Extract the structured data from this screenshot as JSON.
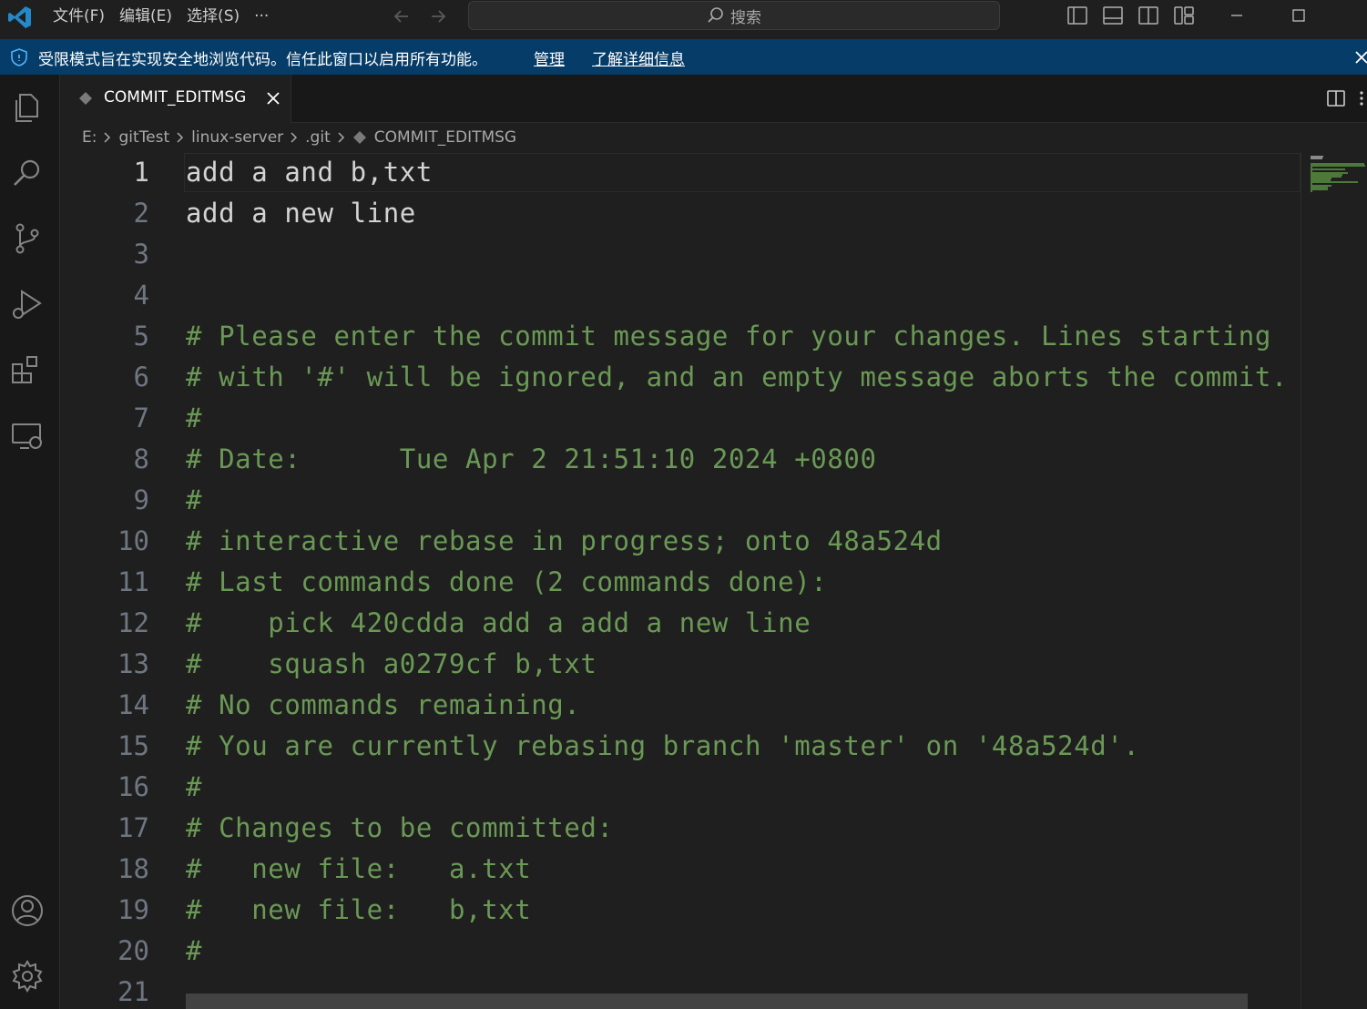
{
  "titlebar": {
    "menu": [
      "文件(F)",
      "编辑(E)",
      "选择(S)",
      "···"
    ],
    "search_label": "搜索"
  },
  "banner": {
    "message": "受限模式旨在实现安全地浏览代码。信任此窗口以启用所有功能。",
    "manage_label": "管理",
    "learn_more_label": "了解详细信息"
  },
  "tab": {
    "label": "COMMIT_EDITMSG"
  },
  "breadcrumbs": [
    "E:",
    "gitTest",
    "linux-server",
    ".git",
    "COMMIT_EDITMSG"
  ],
  "editor": {
    "lines": [
      {
        "num": "1",
        "text": "add a and b,txt",
        "comment": false
      },
      {
        "num": "2",
        "text": "add a new line",
        "comment": false
      },
      {
        "num": "3",
        "text": "",
        "comment": false
      },
      {
        "num": "4",
        "text": "",
        "comment": false
      },
      {
        "num": "5",
        "text": "# Please enter the commit message for your changes. Lines starting",
        "comment": true
      },
      {
        "num": "6",
        "text": "# with '#' will be ignored, and an empty message aborts the commit.",
        "comment": true
      },
      {
        "num": "7",
        "text": "#",
        "comment": true
      },
      {
        "num": "8",
        "text": "# Date:      Tue Apr 2 21:51:10 2024 +0800",
        "comment": true
      },
      {
        "num": "9",
        "text": "#",
        "comment": true
      },
      {
        "num": "10",
        "text": "# interactive rebase in progress; onto 48a524d",
        "comment": true
      },
      {
        "num": "11",
        "text": "# Last commands done (2 commands done):",
        "comment": true
      },
      {
        "num": "12",
        "text": "#    pick 420cdda add a add a new line",
        "comment": true
      },
      {
        "num": "13",
        "text": "#    squash a0279cf b,txt",
        "comment": true
      },
      {
        "num": "14",
        "text": "# No commands remaining.",
        "comment": true
      },
      {
        "num": "15",
        "text": "# You are currently rebasing branch 'master' on '48a524d'.",
        "comment": true
      },
      {
        "num": "16",
        "text": "#",
        "comment": true
      },
      {
        "num": "17",
        "text": "# Changes to be committed:",
        "comment": true
      },
      {
        "num": "18",
        "text": "#   new file:   a.txt",
        "comment": true
      },
      {
        "num": "19",
        "text": "#   new file:   b,txt",
        "comment": true
      },
      {
        "num": "20",
        "text": "#",
        "comment": true
      },
      {
        "num": "21",
        "text": "",
        "comment": false
      }
    ]
  },
  "colors": {
    "comment": "#6a9955",
    "text": "#d4d4d4",
    "line_number": "#6e7681",
    "banner": "#063c68",
    "accent": "#0078d4"
  }
}
